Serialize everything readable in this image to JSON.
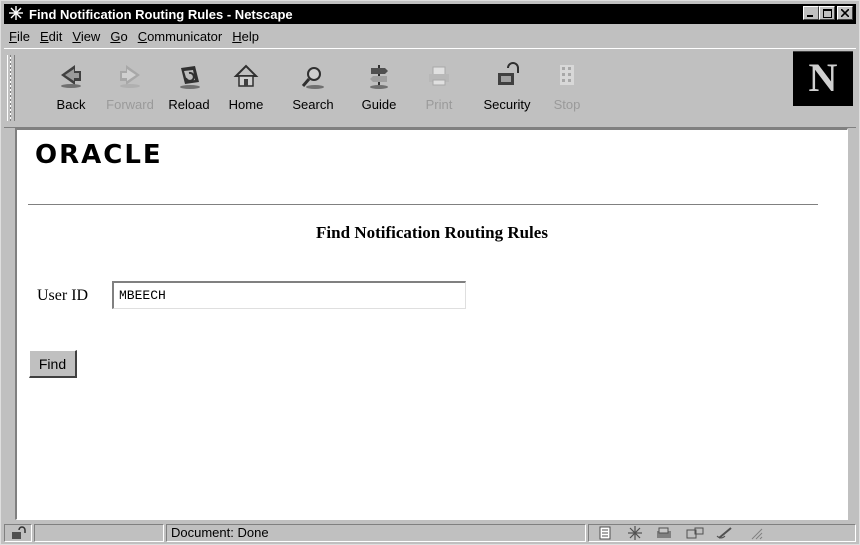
{
  "window": {
    "title": "Find Notification Routing Rules - Netscape",
    "controls": {
      "minimize": "_",
      "maximize": "□",
      "close": "✕"
    }
  },
  "menu": [
    {
      "key": "F",
      "rest": "ile"
    },
    {
      "key": "E",
      "rest": "dit"
    },
    {
      "key": "V",
      "rest": "iew"
    },
    {
      "key": "G",
      "rest": "o"
    },
    {
      "key": "C",
      "rest": "ommunicator"
    },
    {
      "key": "H",
      "rest": "elp"
    }
  ],
  "toolbar": {
    "back": "Back",
    "forward": "Forward",
    "reload": "Reload",
    "home": "Home",
    "search": "Search",
    "guide": "Guide",
    "print": "Print",
    "security": "Security",
    "stop": "Stop",
    "logo": "N"
  },
  "page": {
    "logo": "ORACLE",
    "title": "Find Notification Routing Rules",
    "user_id_label": "User ID",
    "user_id_value": "MBEECH",
    "find_label": "Find"
  },
  "status": {
    "text": "Document: Done"
  }
}
